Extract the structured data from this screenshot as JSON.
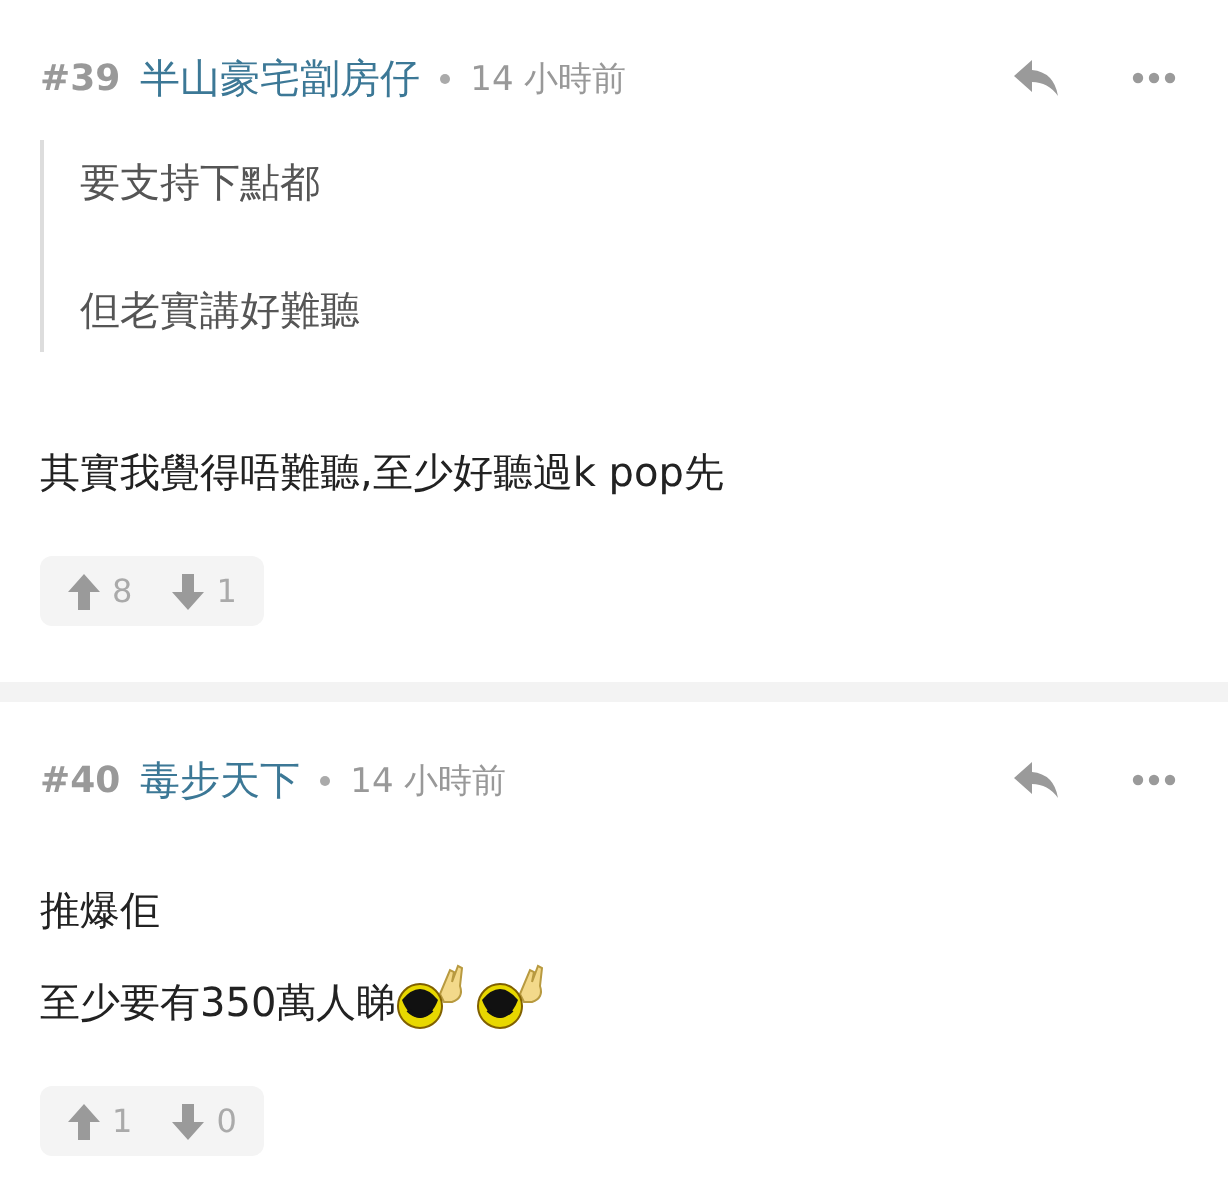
{
  "posts": [
    {
      "number": "#39",
      "author": "半山豪宅劏房仔",
      "time": "14 小時前",
      "quote": [
        "要支持下點都",
        "但老實講好難聽"
      ],
      "lines": [
        {
          "text": "其實我覺得唔難聽,至少好聽過k pop先"
        }
      ],
      "upvotes": "8",
      "downvotes": "1"
    },
    {
      "number": "#40",
      "author": "毒步天下",
      "time": "14 小時前",
      "lines": [
        {
          "text": "推爆佢"
        },
        {
          "text": "至少要有350萬人睇",
          "emoticons": [
            {
              "kind": "rock"
            },
            {
              "kind": "rock"
            }
          ]
        }
      ],
      "upvotes": "1",
      "downvotes": "0"
    }
  ]
}
